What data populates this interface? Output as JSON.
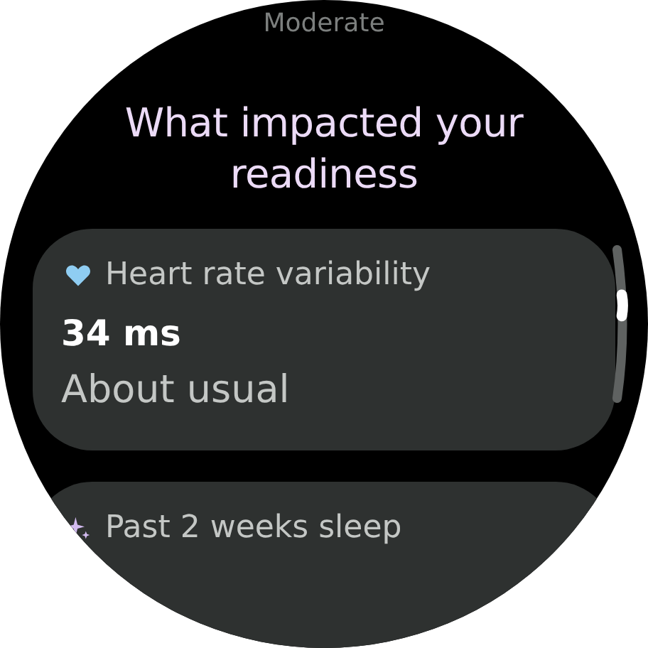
{
  "header": {
    "status": "Moderate",
    "title": "What impacted your readiness"
  },
  "cards": [
    {
      "kind": "heart",
      "label": "Heart rate variability",
      "value": "34 ms",
      "note": "About usual"
    },
    {
      "kind": "sparkle",
      "label": "Past 2 weeks sleep"
    }
  ]
}
